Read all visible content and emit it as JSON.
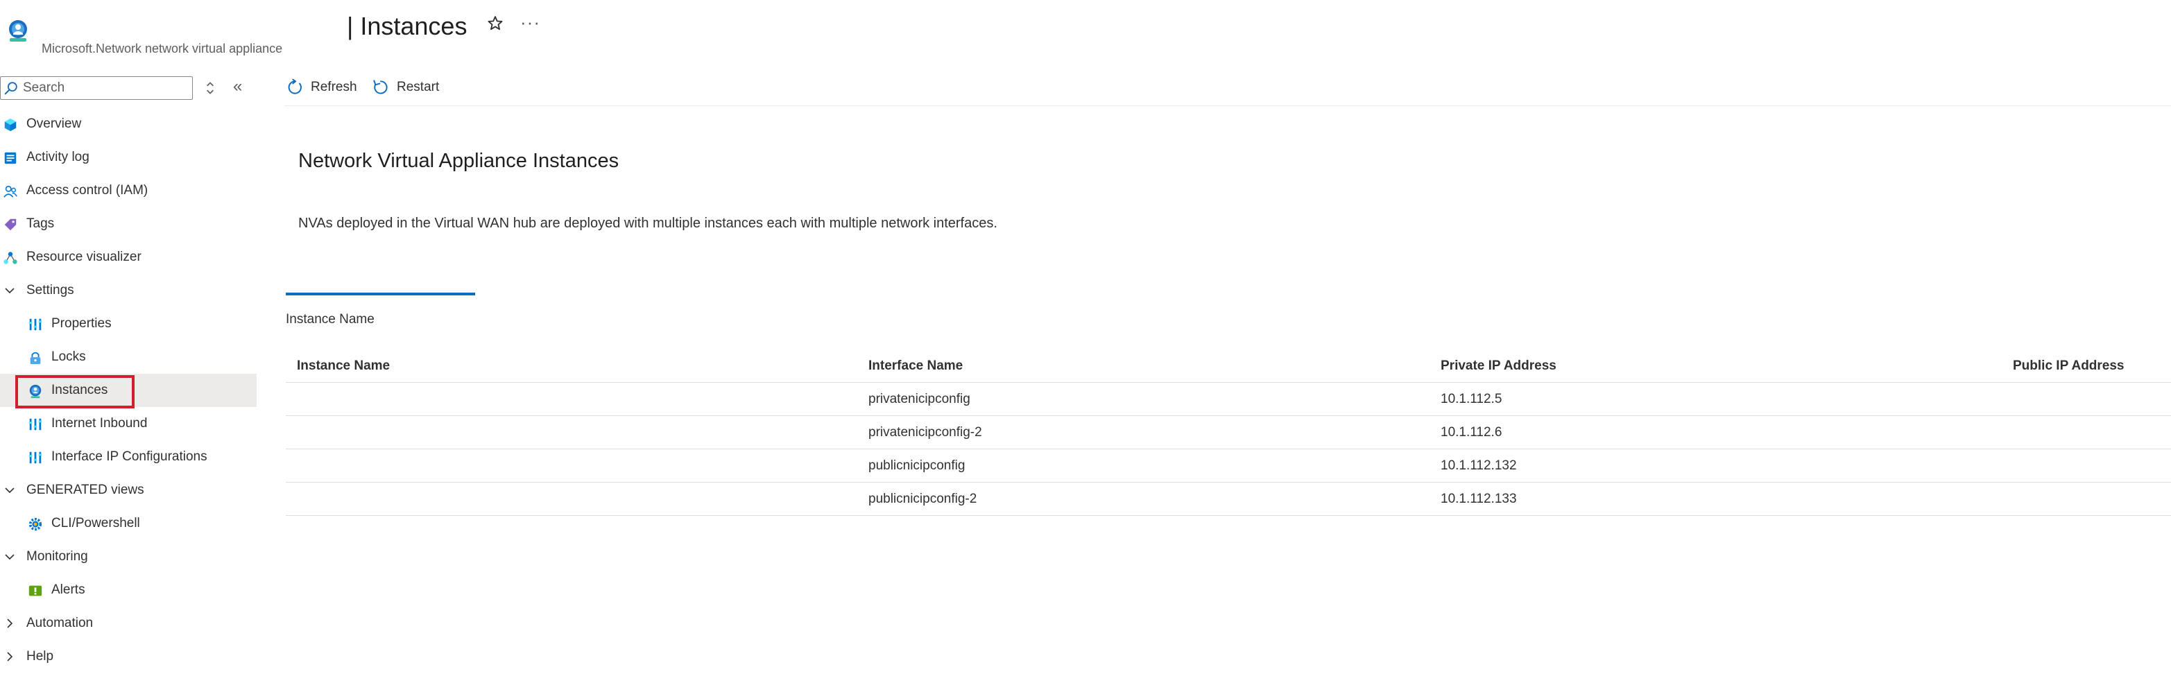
{
  "header": {
    "title": "| Instances",
    "subtitle": "Microsoft.Network network virtual appliance",
    "favorite_icon": "star-icon",
    "more_label": "···"
  },
  "sidebar": {
    "search": {
      "placeholder": "Search",
      "value": ""
    },
    "collapse_label": "«",
    "items": [
      {
        "label": "Overview",
        "icon": "overview-icon"
      },
      {
        "label": "Activity log",
        "icon": "activity-log-icon"
      },
      {
        "label": "Access control (IAM)",
        "icon": "iam-people-icon"
      },
      {
        "label": "Tags",
        "icon": "tag-icon"
      },
      {
        "label": "Resource visualizer",
        "icon": "visualizer-icon"
      },
      {
        "label": "Settings",
        "type": "group",
        "expanded": true
      },
      {
        "label": "Properties",
        "icon": "properties-icon"
      },
      {
        "label": "Locks",
        "icon": "lock-icon"
      },
      {
        "label": "Instances",
        "icon": "instances-icon",
        "selected": true
      },
      {
        "label": "Internet Inbound",
        "icon": "properties-icon"
      },
      {
        "label": "Interface IP Configurations",
        "icon": "properties-icon"
      },
      {
        "label": "GENERATED views",
        "type": "group",
        "expanded": true
      },
      {
        "label": "CLI/Powershell",
        "icon": "gear-icon"
      },
      {
        "label": "Monitoring",
        "type": "group",
        "expanded": true
      },
      {
        "label": "Alerts",
        "icon": "alerts-icon"
      },
      {
        "label": "Automation",
        "type": "group",
        "expanded": false
      },
      {
        "label": "Help",
        "type": "group",
        "expanded": false
      }
    ]
  },
  "toolbar": {
    "refresh_label": "Refresh",
    "restart_label": "Restart"
  },
  "content": {
    "heading": "Network Virtual Appliance Instances",
    "description": "NVAs deployed in the Virtual WAN hub are deployed with multiple instances each with multiple network interfaces.",
    "filter_label": "Instance Name",
    "table": {
      "columns": [
        "Instance Name",
        "Interface Name",
        "Private IP Address",
        "Public IP Address"
      ],
      "rows": [
        [
          "",
          "privatenicipconfig",
          "10.1.112.5",
          ""
        ],
        [
          "",
          "privatenicipconfig-2",
          "10.1.112.6",
          ""
        ],
        [
          "",
          "publicnicipconfig",
          "10.1.112.132",
          ""
        ],
        [
          "",
          "publicnicipconfig-2",
          "10.1.112.133",
          ""
        ]
      ]
    }
  },
  "colors": {
    "accent": "#0f6cbd",
    "selection_outline": "#d0202b",
    "selected_background": "#edebe9"
  }
}
